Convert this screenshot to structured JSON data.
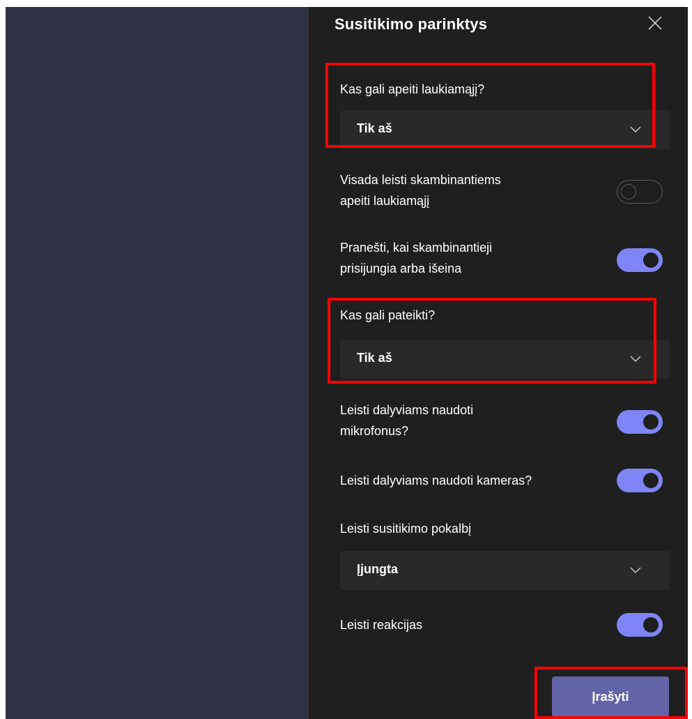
{
  "panel": {
    "title": "Susitikimo parinktys"
  },
  "options": {
    "lobby_bypass": {
      "label": "Kas gali apeiti laukiamąjį?",
      "selected": "Tik aš"
    },
    "callers_bypass": {
      "label_line1": "Visada leisti skambinantiems",
      "label_line2": "apeiti laukiamąjį",
      "state": "off"
    },
    "announce": {
      "label_line1": "Pranešti, kai skambinantieji",
      "label_line2": "prisijungia arba išeina",
      "state": "on"
    },
    "presenters": {
      "label": "Kas gali pateikti?",
      "selected": "Tik aš"
    },
    "mics": {
      "label_line1": "Leisti dalyviams naudoti",
      "label_line2": "mikrofonus?",
      "state": "on"
    },
    "cameras": {
      "label": "Leisti dalyviams naudoti kameras?",
      "state": "on"
    },
    "chat": {
      "label": "Leisti susitikimo pokalbį",
      "selected": "Įjungta"
    },
    "reactions": {
      "label": "Leisti reakcijas",
      "state": "on"
    }
  },
  "footer": {
    "save_label": "Įrašyti"
  },
  "colors": {
    "panel_bg": "#1f1f1f",
    "left_bg": "#2f3146",
    "toggle_on": "#7f85f5",
    "save_button": "#6264a7",
    "highlight": "#ff0000"
  },
  "icons": {
    "close": "close-icon",
    "dropdown": "chevron-down-icon"
  }
}
